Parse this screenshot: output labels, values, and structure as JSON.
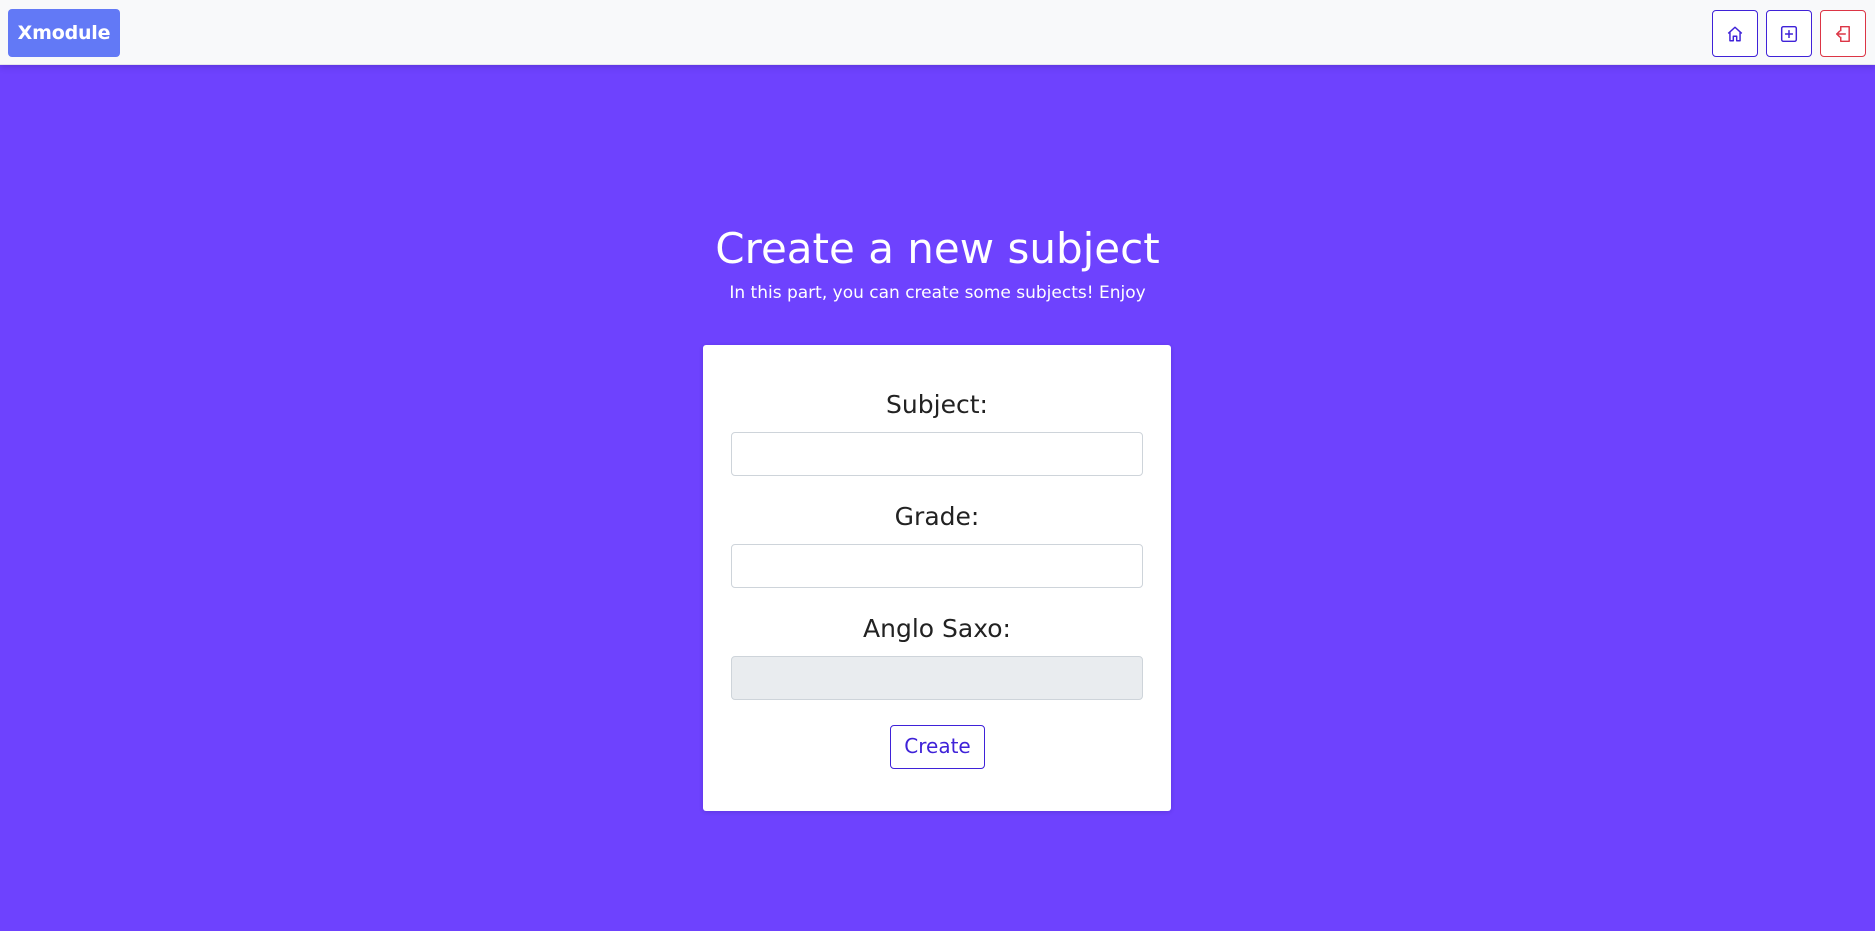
{
  "navbar": {
    "brand": "Xmodule",
    "buttons": [
      {
        "icon": "home-icon",
        "color": "#3f22d8"
      },
      {
        "icon": "plus-square-icon",
        "color": "#3f22d8"
      },
      {
        "icon": "logout-icon",
        "color": "#dc3545"
      }
    ]
  },
  "page": {
    "title": "Create a new subject",
    "subtitle": "In this part, you can create some subjects! Enjoy"
  },
  "form": {
    "subject_label": "Subject:",
    "subject_value": "",
    "grade_label": "Grade:",
    "grade_value": "",
    "anglo_label": "Anglo Saxo:",
    "anglo_value": "",
    "submit_label": "Create"
  },
  "colors": {
    "background": "#6e42fe",
    "navbar": "#f8f9fa",
    "brand": "#6279f6",
    "accent": "#3f22d8",
    "danger": "#dc3545",
    "disabled_field": "#e9ecef"
  }
}
